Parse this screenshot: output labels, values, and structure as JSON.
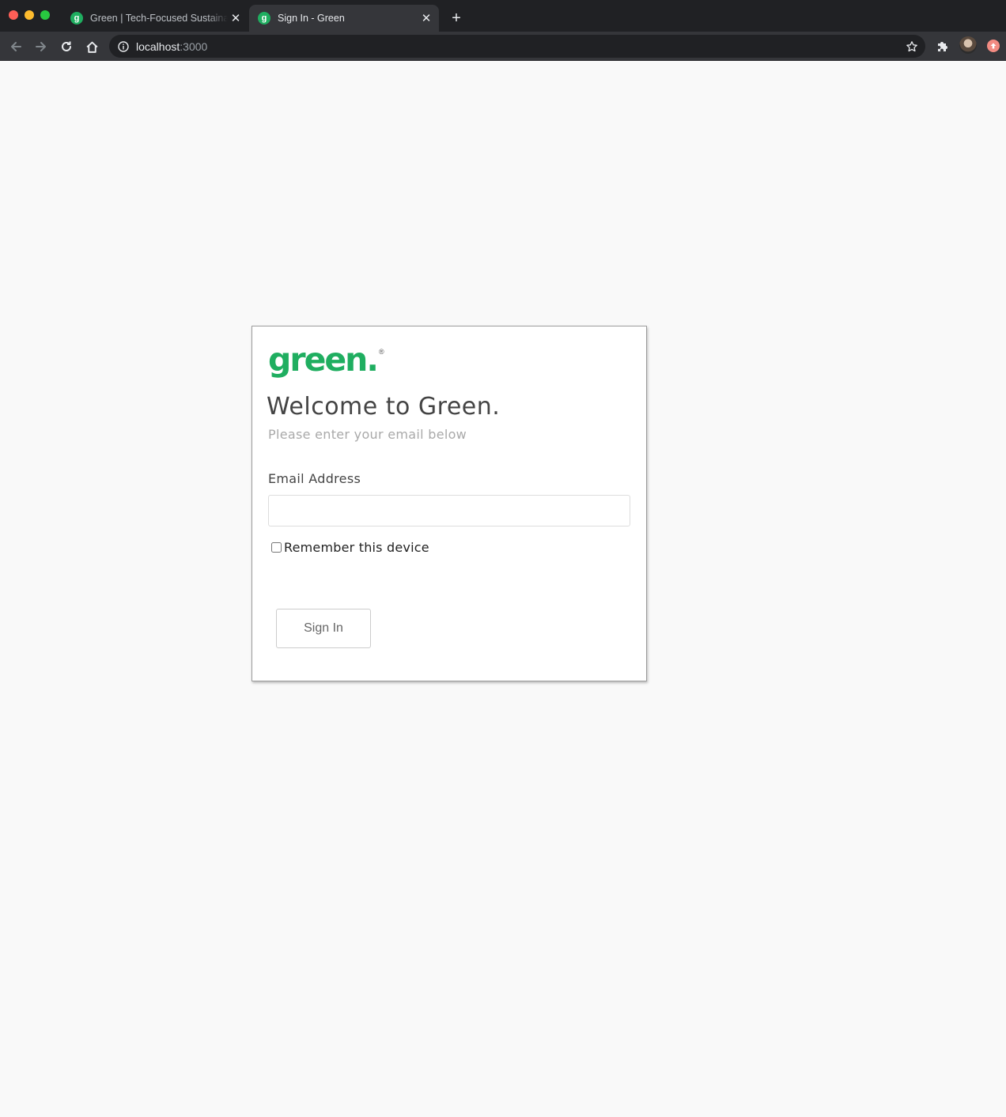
{
  "browser": {
    "tabs": [
      {
        "title": "Green | Tech-Focused Sustaina",
        "favicon_letter": "g",
        "active": false
      },
      {
        "title": "Sign In - Green",
        "favicon_letter": "g",
        "active": true
      }
    ],
    "new_tab_glyph": "+",
    "close_glyph": "✕",
    "address": {
      "host": "localhost",
      "port": ":3000"
    },
    "icons": [
      "back-arrow-icon",
      "forward-arrow-icon",
      "reload-icon",
      "home-icon",
      "info-icon",
      "bookmark-star-icon",
      "extensions-puzzle-icon",
      "profile-avatar",
      "update-badge-icon"
    ]
  },
  "page": {
    "logo": {
      "text": "green.",
      "registered_mark": "®"
    },
    "heading": "Welcome to Green.",
    "subtitle": "Please enter your email below",
    "email": {
      "label": "Email Address",
      "value": "",
      "placeholder": ""
    },
    "remember": {
      "label": "Remember this device",
      "checked": false
    },
    "submit_label": "Sign In"
  },
  "colors": {
    "brand_green": "#1fae60",
    "heading": "#444444",
    "subtitle": "#a9a9a9",
    "page_background": "#f9f9f9",
    "chrome_dark": "#202124",
    "chrome_toolbar": "#35363a"
  }
}
